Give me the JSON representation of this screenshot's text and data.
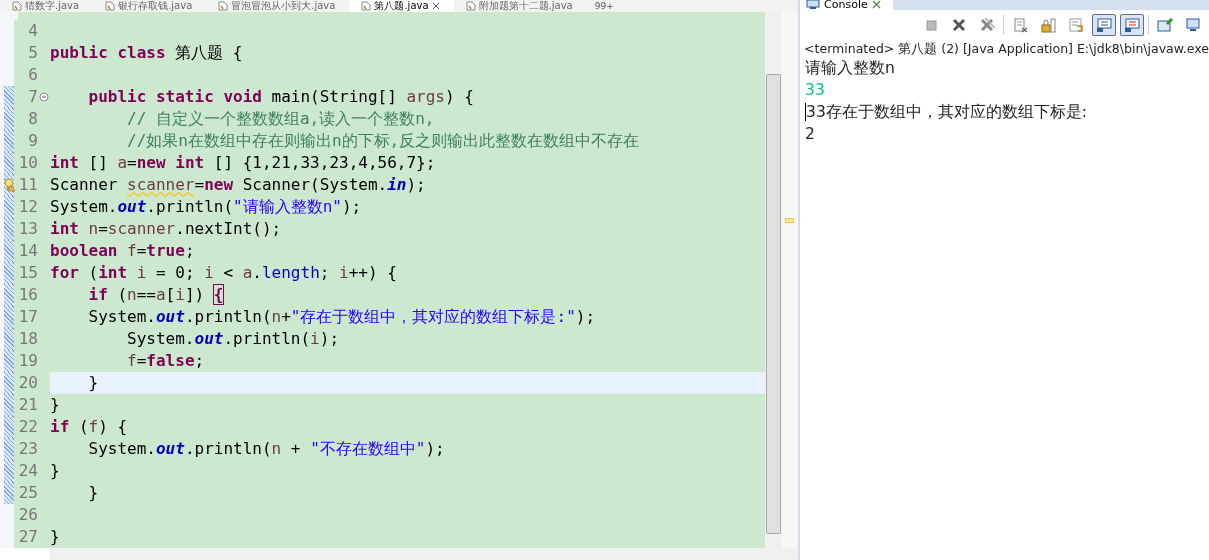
{
  "editor_tabs": [
    {
      "label": "猜数字.java",
      "selected": false
    },
    {
      "label": "银行存取钱.java",
      "selected": false
    },
    {
      "label": "冒泡冒泡从小到大.java",
      "selected": false
    },
    {
      "label": "第八题.java",
      "selected": true
    },
    {
      "label": "附加题第十二题.java",
      "selected": false
    }
  ],
  "hidden_tabs_count": "99+",
  "code_lines": [
    {
      "number": "4",
      "kind": "plain",
      "current": false,
      "changed": false
    },
    {
      "number": "5",
      "kind": "plain",
      "current": false,
      "changed": false,
      "segments": [
        {
          "kind": "keyword",
          "text": "public"
        },
        {
          "kind": "keyword",
          "text": " class"
        },
        {
          "kind": "plain",
          "text": " 第八题 {"
        }
      ]
    },
    {
      "number": "6",
      "kind": "plain",
      "current": false,
      "changed": false
    },
    {
      "number": "7",
      "kind": "fold",
      "current": false,
      "changed": true,
      "segments": [
        {
          "kind": "keyword",
          "text": "    public"
        },
        {
          "kind": "keyword",
          "text": " static"
        },
        {
          "kind": "keyword",
          "text": " void"
        },
        {
          "kind": "plain",
          "text": " main(String[] "
        },
        {
          "kind": "variable",
          "text": "args"
        },
        {
          "kind": "plain",
          "text": ") {"
        }
      ]
    },
    {
      "number": "8",
      "kind": "plain",
      "current": false,
      "changed": true,
      "segments": [
        {
          "kind": "comment",
          "text": "        // 自定义一个整数数组a,读入一个整数n,"
        }
      ]
    },
    {
      "number": "9",
      "kind": "plain",
      "current": false,
      "changed": true,
      "segments": [
        {
          "kind": "comment",
          "text": "        //如果n在数组中存在则输出n的下标,反之则输出此整数在数组中不存在"
        }
      ]
    },
    {
      "number": "10",
      "kind": "plain",
      "current": false,
      "changed": true,
      "segments": [
        {
          "kind": "keyword",
          "text": "int"
        },
        {
          "kind": "plain",
          "text": " [] "
        },
        {
          "kind": "variable",
          "text": "a"
        },
        {
          "kind": "plain",
          "text": "="
        },
        {
          "kind": "keyword",
          "text": "new"
        },
        {
          "kind": "keyword",
          "text": " int"
        },
        {
          "kind": "plain",
          "text": " [] {1,21,33,23,4,56,7};"
        }
      ]
    },
    {
      "number": "11",
      "kind": "warning",
      "current": false,
      "changed": true,
      "segments": [
        {
          "kind": "plain",
          "text": "Scanner "
        },
        {
          "kind": "warned",
          "text": "scanner"
        },
        {
          "kind": "plain",
          "text": "="
        },
        {
          "kind": "keyword",
          "text": "new"
        },
        {
          "kind": "plain",
          "text": " Scanner(System."
        },
        {
          "kind": "field",
          "text": "in"
        },
        {
          "kind": "plain",
          "text": ");"
        }
      ]
    },
    {
      "number": "12",
      "kind": "plain",
      "current": false,
      "changed": true,
      "segments": [
        {
          "kind": "plain",
          "text": "System."
        },
        {
          "kind": "field",
          "text": "out"
        },
        {
          "kind": "plain",
          "text": ".println("
        },
        {
          "kind": "string",
          "text": "\"请输入整数n\""
        },
        {
          "kind": "plain",
          "text": ");"
        }
      ]
    },
    {
      "number": "13",
      "kind": "plain",
      "current": false,
      "changed": true,
      "segments": [
        {
          "kind": "keyword",
          "text": "int"
        },
        {
          "kind": "variable",
          "text": " n"
        },
        {
          "kind": "plain",
          "text": "="
        },
        {
          "kind": "variable",
          "text": "scanner"
        },
        {
          "kind": "plain",
          "text": ".nextInt();"
        }
      ]
    },
    {
      "number": "14",
      "kind": "plain",
      "current": false,
      "changed": true,
      "segments": [
        {
          "kind": "keyword",
          "text": "boolean"
        },
        {
          "kind": "variable",
          "text": " f"
        },
        {
          "kind": "plain",
          "text": "="
        },
        {
          "kind": "keyword",
          "text": "true"
        },
        {
          "kind": "plain",
          "text": ";"
        }
      ]
    },
    {
      "number": "15",
      "kind": "plain",
      "current": false,
      "changed": true,
      "segments": [
        {
          "kind": "keyword",
          "text": "for"
        },
        {
          "kind": "plain",
          "text": " ("
        },
        {
          "kind": "keyword",
          "text": "int"
        },
        {
          "kind": "variable",
          "text": " i"
        },
        {
          "kind": "plain",
          "text": " = 0; "
        },
        {
          "kind": "variable",
          "text": "i"
        },
        {
          "kind": "plain",
          "text": " < "
        },
        {
          "kind": "variable",
          "text": "a"
        },
        {
          "kind": "plain",
          "text": "."
        },
        {
          "kind": "member",
          "text": "length"
        },
        {
          "kind": "plain",
          "text": "; "
        },
        {
          "kind": "variable",
          "text": "i"
        },
        {
          "kind": "plain",
          "text": "++) {"
        }
      ]
    },
    {
      "number": "16",
      "kind": "plain",
      "current": false,
      "changed": true,
      "segments": [
        {
          "kind": "keyword",
          "text": "    if"
        },
        {
          "kind": "plain",
          "text": " ("
        },
        {
          "kind": "variable",
          "text": "n"
        },
        {
          "kind": "plain",
          "text": "=="
        },
        {
          "kind": "variable",
          "text": "a"
        },
        {
          "kind": "plain",
          "text": "["
        },
        {
          "kind": "variable",
          "text": "i"
        },
        {
          "kind": "plain",
          "text": "]) "
        },
        {
          "kind": "bracket",
          "text": "{"
        }
      ]
    },
    {
      "number": "17",
      "kind": "plain",
      "current": false,
      "changed": true,
      "segments": [
        {
          "kind": "plain",
          "text": "    System."
        },
        {
          "kind": "field",
          "text": "out"
        },
        {
          "kind": "plain",
          "text": ".println("
        },
        {
          "kind": "variable",
          "text": "n"
        },
        {
          "kind": "plain",
          "text": "+"
        },
        {
          "kind": "string",
          "text": "\"存在于数组中，其对应的数组下标是:\""
        },
        {
          "kind": "plain",
          "text": ");"
        }
      ]
    },
    {
      "number": "18",
      "kind": "plain",
      "current": false,
      "changed": true,
      "segments": [
        {
          "kind": "plain",
          "text": "        System."
        },
        {
          "kind": "field",
          "text": "out"
        },
        {
          "kind": "plain",
          "text": ".println("
        },
        {
          "kind": "variable",
          "text": "i"
        },
        {
          "kind": "plain",
          "text": ");"
        }
      ]
    },
    {
      "number": "19",
      "kind": "plain",
      "current": false,
      "changed": true,
      "segments": [
        {
          "kind": "variable",
          "text": "        f"
        },
        {
          "kind": "plain",
          "text": "="
        },
        {
          "kind": "keyword",
          "text": "false"
        },
        {
          "kind": "plain",
          "text": ";"
        }
      ]
    },
    {
      "number": "20",
      "kind": "plain",
      "current": true,
      "changed": true,
      "segments": [
        {
          "kind": "plain",
          "text": "    }"
        }
      ]
    },
    {
      "number": "21",
      "kind": "plain",
      "current": false,
      "changed": true,
      "segments": [
        {
          "kind": "plain",
          "text": "}"
        }
      ]
    },
    {
      "number": "22",
      "kind": "plain",
      "current": false,
      "changed": true,
      "segments": [
        {
          "kind": "keyword",
          "text": "if"
        },
        {
          "kind": "plain",
          "text": " ("
        },
        {
          "kind": "variable",
          "text": "f"
        },
        {
          "kind": "plain",
          "text": ") {"
        }
      ]
    },
    {
      "number": "23",
      "kind": "plain",
      "current": false,
      "changed": true,
      "segments": [
        {
          "kind": "plain",
          "text": "    System."
        },
        {
          "kind": "field",
          "text": "out"
        },
        {
          "kind": "plain",
          "text": ".println("
        },
        {
          "kind": "variable",
          "text": "n"
        },
        {
          "kind": "plain",
          "text": " + "
        },
        {
          "kind": "string",
          "text": "\"不存在数组中\""
        },
        {
          "kind": "plain",
          "text": ");"
        }
      ]
    },
    {
      "number": "24",
      "kind": "plain",
      "current": false,
      "changed": true,
      "segments": [
        {
          "kind": "plain",
          "text": "}"
        }
      ]
    },
    {
      "number": "25",
      "kind": "plain",
      "current": false,
      "changed": true,
      "segments": [
        {
          "kind": "plain",
          "text": "    }"
        }
      ]
    },
    {
      "number": "26",
      "kind": "plain",
      "current": false,
      "changed": false
    },
    {
      "number": "27",
      "kind": "plain",
      "current": false,
      "changed": false,
      "segments": [
        {
          "kind": "plain",
          "text": "}"
        }
      ]
    }
  ],
  "console": {
    "title": "Console",
    "toolbar": [
      {
        "kind": "terminate",
        "pressed": false
      },
      {
        "kind": "remove",
        "pressed": false
      },
      {
        "kind": "remove-all",
        "pressed": false
      },
      {
        "kind": "clear",
        "pressed": false
      },
      {
        "kind": "scroll-lock",
        "pressed": false
      },
      {
        "kind": "word-wrap",
        "pressed": false
      },
      {
        "kind": "show-out",
        "pressed": true
      },
      {
        "kind": "show-err",
        "pressed": true
      },
      {
        "kind": "pin",
        "pressed": false
      },
      {
        "kind": "display",
        "pressed": false
      }
    ],
    "status": "<terminated> 第八题 (2) [Java Application] E:\\jdk8\\bin\\javaw.exe",
    "lines": [
      {
        "text": "请输入整数n",
        "kind": "output"
      },
      {
        "text": "33",
        "kind": "input"
      },
      {
        "text": "33存在于数组中，其对应的数组下标是:",
        "kind": "output"
      },
      {
        "text": "2",
        "kind": "output"
      }
    ]
  }
}
